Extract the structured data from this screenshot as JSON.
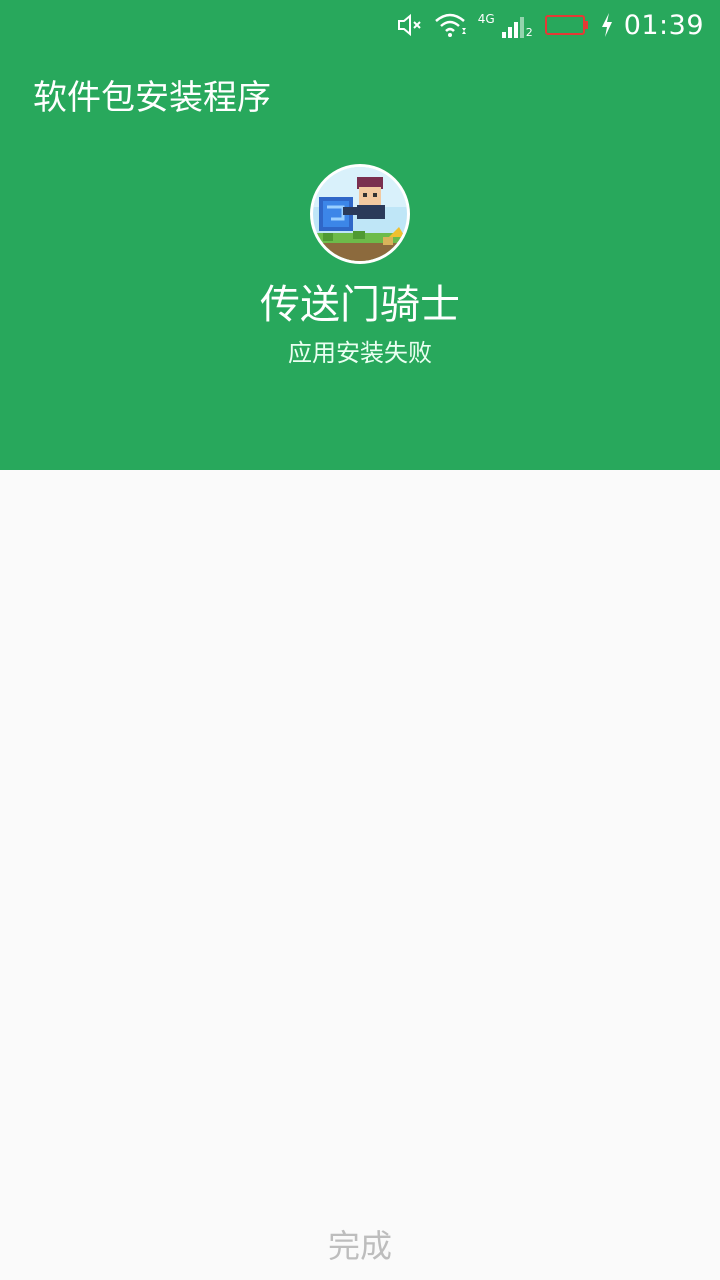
{
  "status_bar": {
    "time": "01:39",
    "network_label": "4G",
    "sim_slot": "2",
    "icons": [
      "mute-icon",
      "wifi-icon",
      "cell-signal-icon",
      "battery-icon",
      "charging-icon"
    ],
    "battery_outline_color": "#e53935"
  },
  "header": {
    "title": "软件包安装程序",
    "background_color": "#28a85c"
  },
  "app": {
    "name": "传送门骑士",
    "status": "应用安装失败"
  },
  "footer": {
    "done_label": "完成"
  }
}
